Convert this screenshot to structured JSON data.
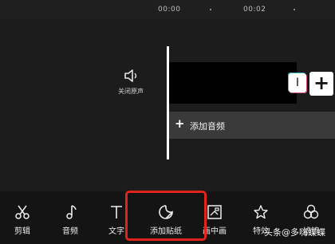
{
  "ruler": {
    "time_start": "00:00",
    "time_mid": "00:02"
  },
  "timeline": {
    "mute_label": "关闭原声",
    "add_audio_label": "添加音频",
    "add_audio_plus": "+",
    "clip_handle": "I",
    "add_clip_symbol": "+"
  },
  "toolbar": {
    "items": [
      {
        "label": "剪辑",
        "icon": "scissors-icon"
      },
      {
        "label": "音频",
        "icon": "music-note-icon"
      },
      {
        "label": "文字",
        "icon": "text-icon"
      },
      {
        "label": "添加贴纸",
        "icon": "sticker-icon",
        "highlighted": true
      },
      {
        "label": "画中画",
        "icon": "picture-in-picture-icon"
      },
      {
        "label": "特效",
        "icon": "effects-star-icon"
      },
      {
        "label": "滤镜",
        "icon": "filter-icon"
      }
    ]
  },
  "watermark": "头条@多嗨蝶蝶",
  "colors": {
    "highlight": "#e0231c",
    "background": "#1f1f1f",
    "toolbar": "#141414",
    "audio_track": "#3a3a3a"
  }
}
